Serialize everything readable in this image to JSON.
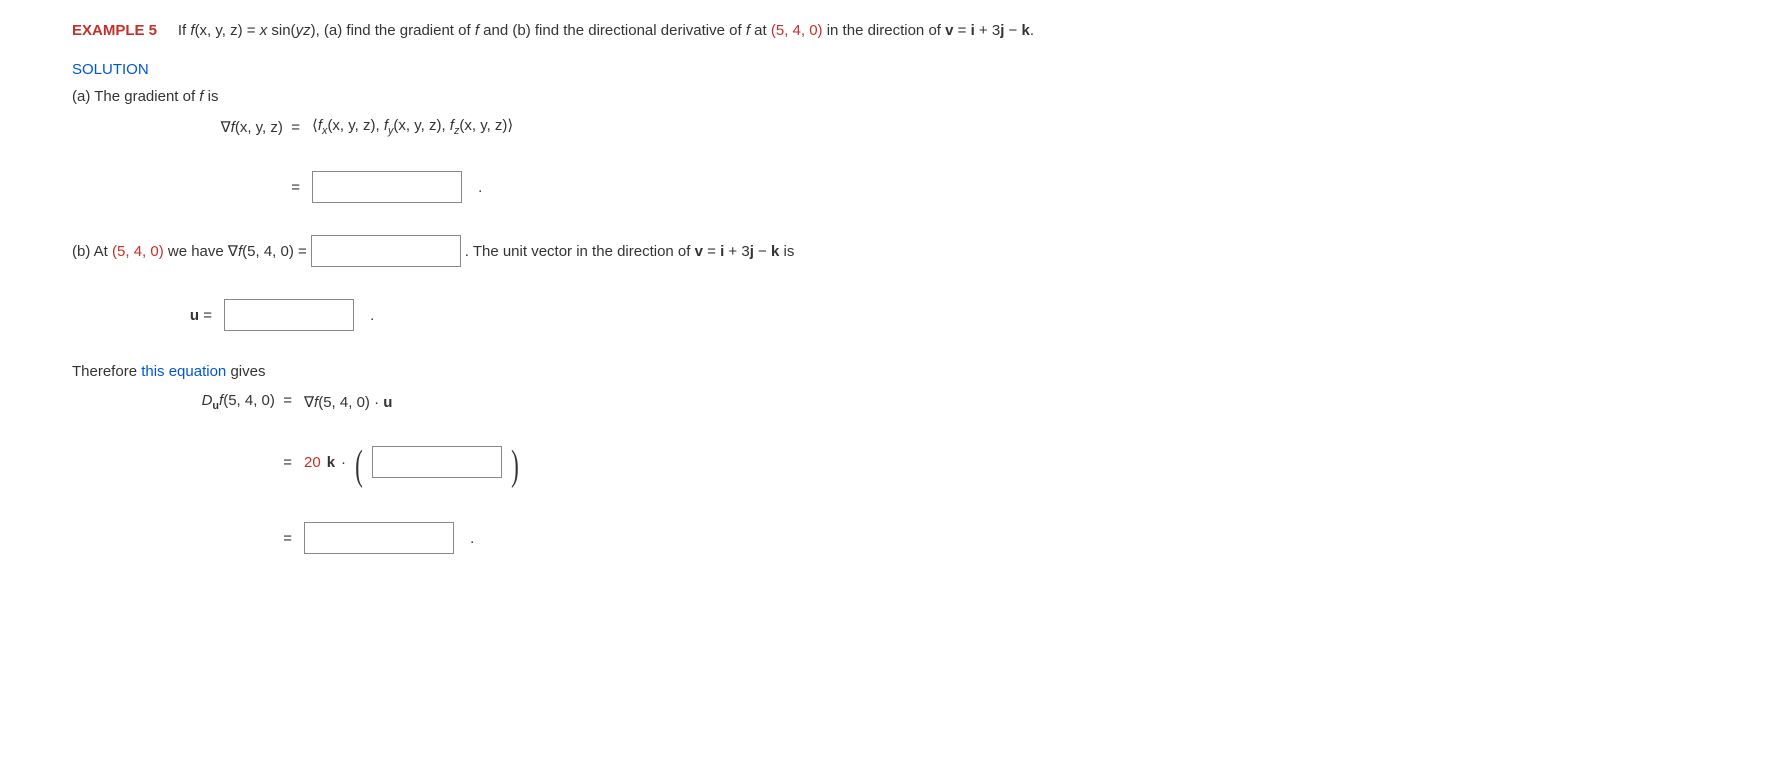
{
  "header": {
    "label": "EXAMPLE 5",
    "prompt_prefix": "If ",
    "func": "f",
    "vars": "(x, y, z)",
    "eq": " = ",
    "func_def": "x sin(yz)",
    "prompt_mid1": ", (a) find the gradient of ",
    "prompt_mid2": " and (b) find the directional derivative of ",
    "at_text": " at ",
    "point": "(5, 4, 0)",
    "dir_text": " in the direction of ",
    "v": "v",
    "v_eq": " = ",
    "i": "i",
    "plus3": " + 3",
    "j": "j",
    "minus": " − ",
    "k": "k",
    "period": "."
  },
  "solution": {
    "label": "SOLUTION",
    "part_a_intro_1": "(a) The gradient of ",
    "part_a_intro_2": " is",
    "grad_lhs_vars": "(x, y, z)",
    "grad_rhs_fx": "(x, y, z), ",
    "grad_rhs_fy": "(x, y, z), ",
    "grad_rhs_fz": "(x, y, z)",
    "equals": "=",
    "period": ".",
    "part_b_1": "(b) At ",
    "part_b_point": "(5, 4, 0)",
    "part_b_2": " we have ",
    "part_b_grad": "(5, 4, 0) = ",
    "part_b_3": ". The unit vector in the direction of ",
    "part_b_is": " is",
    "u": "u",
    "u_eq": " = ",
    "therefore_1": "Therefore ",
    "this_eq": "this equation",
    "therefore_2": " gives",
    "duf_point": "(5, 4, 0)",
    "duf_rhs_point": "(5, 4, 0) · ",
    "twentyk": "20",
    "dot": " · "
  }
}
